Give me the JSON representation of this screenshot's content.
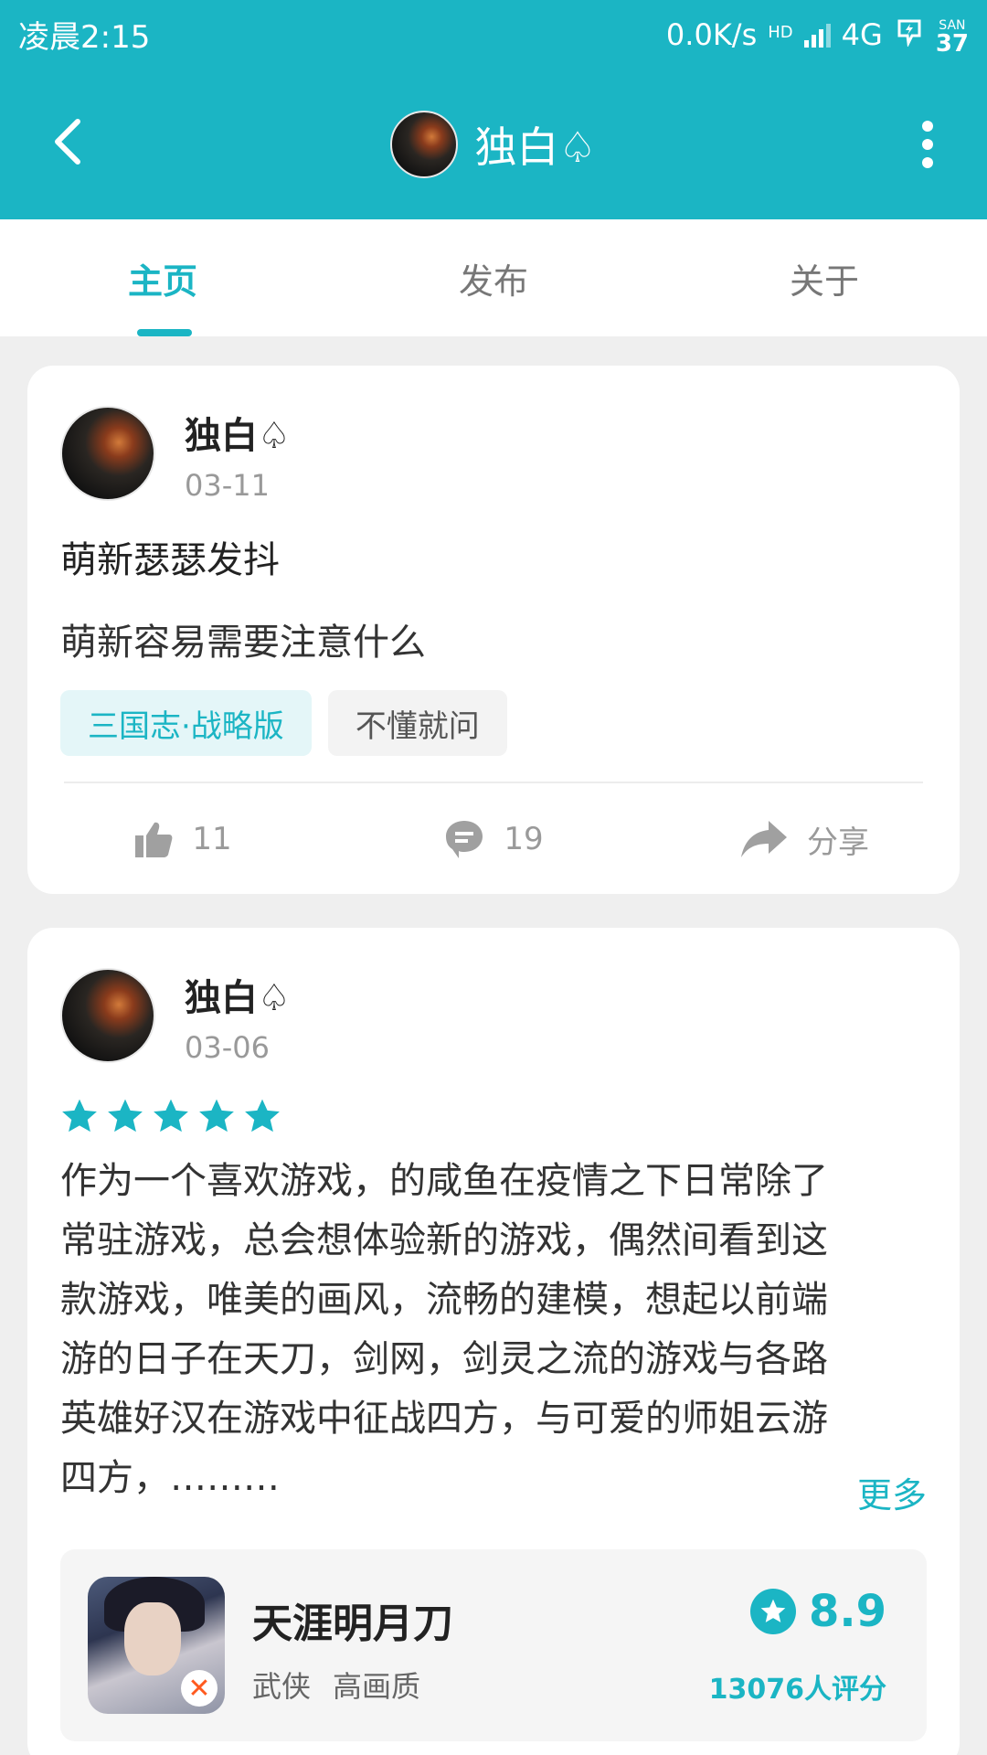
{
  "status_bar": {
    "time": "凌晨2:15",
    "net_speed": "0.0K/s",
    "hd_label": "HD",
    "network": "4G",
    "battery_label": "SAN",
    "battery_level": "37"
  },
  "header": {
    "title": "独白♤",
    "back_icon": "chevron-left-icon",
    "more_icon": "more-vertical-icon"
  },
  "tabs": [
    {
      "label": "主页",
      "active": true
    },
    {
      "label": "发布",
      "active": false
    },
    {
      "label": "关于",
      "active": false
    }
  ],
  "posts": [
    {
      "author": "独白♤",
      "date": "03-11",
      "title": "萌新瑟瑟发抖",
      "body": "萌新容易需要注意什么",
      "tags": [
        "三国志·战略版",
        "不懂就问"
      ],
      "likes": "11",
      "comments": "19",
      "share_label": "分享"
    },
    {
      "author": "独白♤",
      "date": "03-06",
      "stars": 5,
      "review": "作为一个喜欢游戏，的咸鱼在疫情之下日常除了\n常驻游戏，总会想体验新的游戏，偶然间看到这\n款游戏，唯美的画风，流畅的建模，想起以前端\n游的日子在天刀，剑网，剑灵之流的游戏与各路\n英雄好汉在游戏中征战四方，与可爱的师姐云游\n四方，………",
      "more_label": "更多",
      "game": {
        "name": "天涯明月刀",
        "tags": [
          "武侠",
          "高画质"
        ],
        "score": "8.9",
        "rating_count": "13076人评分"
      }
    }
  ],
  "colors": {
    "accent": "#1bb5c4",
    "background": "#efefef"
  }
}
